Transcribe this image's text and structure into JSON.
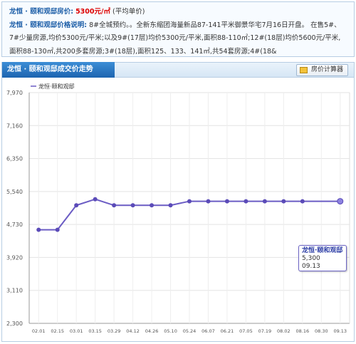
{
  "info": {
    "row1_label": "龙恒 · 颐和观邸房价:",
    "row1_price": "5300元/㎡",
    "row1_note": "(平均单价)",
    "row2_label": "龙恒 · 颐和观邸价格说明:",
    "row2_text": "8#全城预约。。全新东缩团海量新品87-141平米御景华宅7月16日开盘。 在售5#、7#少量房源,均价5300元/平米;以及9#(17层)均价5300元/平米,面积88-110㎡;12#(18层)均价5600元/平米,面积88-130㎡,共200多套房源;3#(18层),面积125、133、141㎡,共54套房源;4#(18&"
  },
  "header": {
    "tab_title": "龙恒 · 颐和观邸成交价走势",
    "calc_button": "房价计算器",
    "calc_icon": "calculator-icon"
  },
  "tooltip": {
    "title": "龙恒·颐和观邸",
    "value": "5,300",
    "date": "09.13"
  },
  "chart_data": {
    "type": "line",
    "series": [
      {
        "name": "龙恒·颐和观邸",
        "color": "#6b5cc4",
        "values": [
          4600,
          4600,
          5200,
          5350,
          5200,
          5200,
          5200,
          5200,
          5300,
          5300,
          5300,
          5300,
          5300,
          5300,
          5300,
          5300
        ]
      }
    ],
    "categories": [
      "02.01",
      "02.15",
      "03.01",
      "03.15",
      "03.29",
      "04.12",
      "04.26",
      "05.10",
      "05.24",
      "06.07",
      "06.21",
      "07.05",
      "07.19",
      "08.02",
      "08.16",
      "08.30",
      "09.13"
    ],
    "point_categories": [
      "02.01",
      "02.15",
      "03.01",
      "03.15",
      "03.29",
      "04.12",
      "04.26",
      "05.10",
      "05.24",
      "06.07",
      "06.21",
      "07.05",
      "07.19",
      "08.02",
      "08.16",
      "09.13"
    ],
    "yticks": [
      "7,970",
      "7,160",
      "6,350",
      "5,540",
      "4,730",
      "3,920",
      "3,110",
      "2,300"
    ],
    "ylim": [
      2300,
      7970
    ],
    "grid": true,
    "legend_position": "top-left"
  }
}
